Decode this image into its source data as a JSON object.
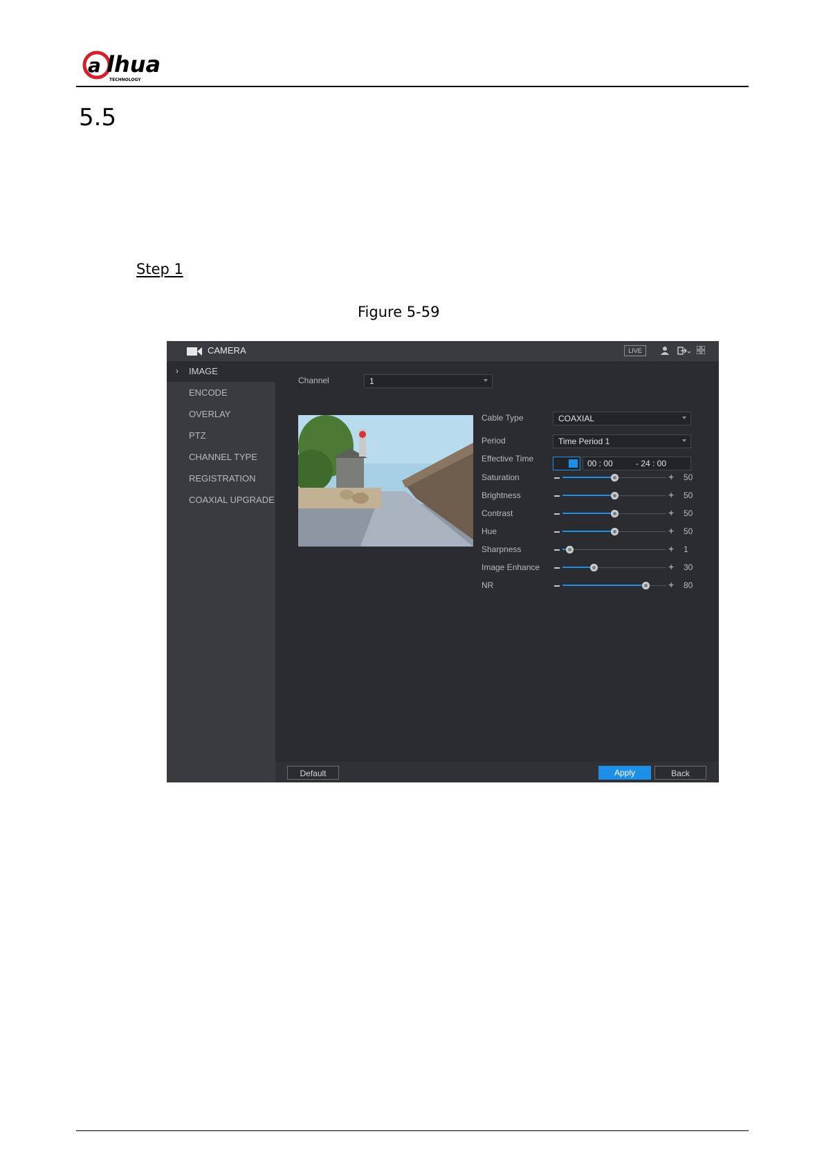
{
  "document": {
    "brand": "alhua",
    "brand_tagline": "TECHNOLOGY",
    "section_number": "5.5",
    "step_label": "Step 1",
    "figure_caption": "Figure 5-59"
  },
  "screen": {
    "title": "CAMERA",
    "live_label": "LIVE",
    "sidebar": {
      "items": [
        {
          "label": "IMAGE",
          "active": true
        },
        {
          "label": "ENCODE"
        },
        {
          "label": "OVERLAY"
        },
        {
          "label": "PTZ"
        },
        {
          "label": "CHANNEL TYPE"
        },
        {
          "label": "REGISTRATION"
        },
        {
          "label": "COAXIAL UPGRADE"
        }
      ]
    },
    "channel": {
      "label": "Channel",
      "value": "1"
    },
    "cable_type": {
      "label": "Cable Type",
      "value": "COAXIAL"
    },
    "period": {
      "label": "Period",
      "value": "Time Period 1"
    },
    "effective_time": {
      "label": "Effective Time",
      "start": "00 : 00",
      "end": "- 24 : 00"
    },
    "sliders": [
      {
        "label": "Saturation",
        "value": 50,
        "max": 100
      },
      {
        "label": "Brightness",
        "value": 50,
        "max": 100
      },
      {
        "label": "Contrast",
        "value": 50,
        "max": 100
      },
      {
        "label": "Hue",
        "value": 50,
        "max": 100
      },
      {
        "label": "Sharpness",
        "value": 1,
        "max": 15
      },
      {
        "label": "Image Enhance",
        "value": 30,
        "max": 100
      },
      {
        "label": "NR",
        "value": 80,
        "max": 100
      }
    ],
    "buttons": {
      "default": "Default",
      "apply": "Apply",
      "back": "Back"
    },
    "colors": {
      "accent": "#1e8fe6",
      "background": "#2b2c30",
      "sidebar": "#3a3b40"
    }
  }
}
